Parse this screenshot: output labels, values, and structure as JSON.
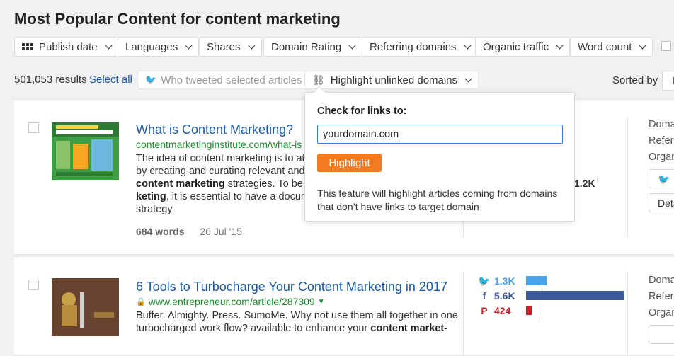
{
  "page": {
    "title": "Most Popular Content for content marketing"
  },
  "filters": [
    {
      "label": "Publish date",
      "icon": "grid-icon"
    },
    {
      "label": "Languages"
    },
    {
      "label": "Shares"
    },
    {
      "label": "Domain Rating"
    },
    {
      "label": "Referring domains"
    },
    {
      "label": "Organic traffic"
    },
    {
      "label": "Word count"
    }
  ],
  "toolbar": {
    "results_count": "501,053 results",
    "select_all": "Select all",
    "tweet_button": "Who tweeted selected articles",
    "highlight_button": "Highlight unlinked domains",
    "sorted_by": "Sorted by",
    "sort_value": "F"
  },
  "popup": {
    "heading": "Check for links to:",
    "input_value": "yourdomain.com",
    "button": "Highlight",
    "description": "This feature will highlight articles coming from domains that don’t have links to target domain"
  },
  "articles": [
    {
      "title": "What is Content Marketing?",
      "url": "contentmarketinginstitute.com/what-is",
      "desc_lines": [
        "The idea of content marketing is to att",
        "by creating and curating relevant and",
        "content marketing",
        " strategies. To be e",
        "keting",
        ", it is essential to have a docum",
        "strategy"
      ],
      "words": "684 words",
      "date": "26 Jul '15",
      "stat_value": "1.2K",
      "side_labels": [
        "Doma",
        "Refer",
        "Organ"
      ],
      "side_buttons": [
        "W",
        "Deta"
      ]
    },
    {
      "title": "6 Tools to Turbocharge Your Content Marketing in 2017",
      "url": "www.entrepreneur.com/article/287309",
      "desc_lines": [
        "Buffer. Almighty. Press. SumoMe. Why not use them all together in one",
        "turbocharged work flow? available to enhance your ",
        "content market-"
      ],
      "shares": [
        {
          "network": "twitter",
          "icon": "twitter-icon",
          "value": "1.3K",
          "ratio": 0.21,
          "color": "#4aa3e8"
        },
        {
          "network": "facebook",
          "icon": "facebook-icon",
          "value": "5.6K",
          "ratio": 1.0,
          "color": "#3b5998"
        },
        {
          "network": "pinterest",
          "icon": "pinterest-icon",
          "value": "424",
          "ratio": 0.06,
          "color": "#cb2027"
        }
      ],
      "side_labels": [
        "Doma",
        "Refer",
        "Organ"
      ]
    }
  ],
  "icons": {
    "twitter": "𝕥",
    "facebook": "f",
    "pinterest": "P"
  }
}
